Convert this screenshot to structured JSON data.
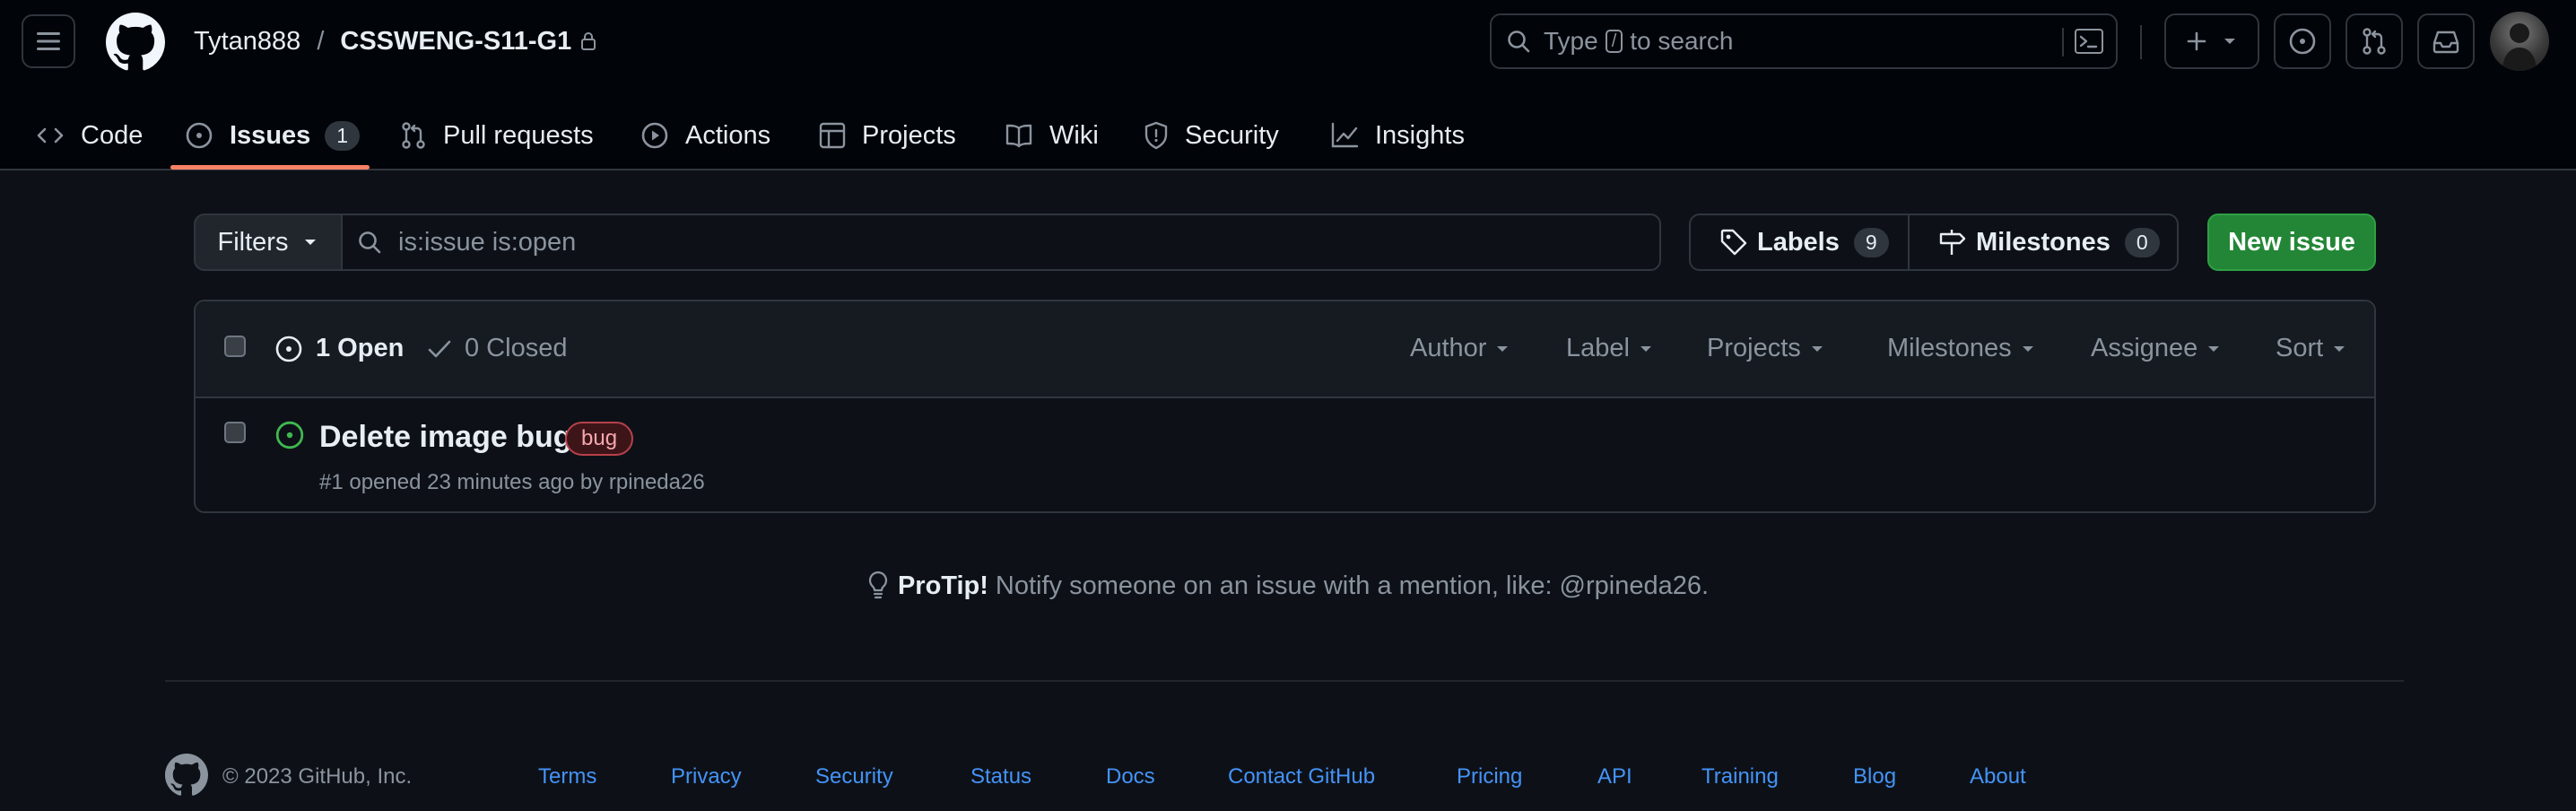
{
  "header": {
    "owner": "Tytan888",
    "separator": "/",
    "repo": "CSSWENG-S11-G1",
    "search_prefix": "Type",
    "search_key": "/",
    "search_suffix": "to search"
  },
  "nav": {
    "code": "Code",
    "issues": "Issues",
    "issues_count": "1",
    "pull_requests": "Pull requests",
    "actions": "Actions",
    "projects": "Projects",
    "wiki": "Wiki",
    "security": "Security",
    "insights": "Insights"
  },
  "toolbar": {
    "filters": "Filters",
    "query": "is:issue is:open",
    "labels": "Labels",
    "labels_count": "9",
    "milestones": "Milestones",
    "milestones_count": "0",
    "new_issue": "New issue"
  },
  "list": {
    "open": "1 Open",
    "closed": "0 Closed",
    "filters": {
      "author": "Author",
      "label": "Label",
      "projects": "Projects",
      "milestones": "Milestones",
      "assignee": "Assignee",
      "sort": "Sort"
    },
    "issues": [
      {
        "title": "Delete image bug",
        "label": "bug",
        "meta_prefix": "#1 opened 23 minutes ago by",
        "author": "rpineda26"
      }
    ]
  },
  "protip": {
    "strong": "ProTip!",
    "text": "Notify someone on an issue with a mention, like: @rpineda26."
  },
  "footer": {
    "copyright": "© 2023 GitHub, Inc.",
    "links": [
      "Terms",
      "Privacy",
      "Security",
      "Status",
      "Docs",
      "Contact GitHub",
      "Pricing",
      "API",
      "Training",
      "Blog",
      "About"
    ]
  },
  "colors": {
    "background": "#0d1117",
    "header_bg": "#010409",
    "accent_underline": "#f78166",
    "open_green": "#3fb950",
    "button_green": "#238636",
    "link_blue": "#4493f8",
    "bug_label": "#f85149"
  },
  "icons": [
    "hamburger-icon",
    "github-logo",
    "lock-icon",
    "search-icon",
    "command-palette-icon",
    "plus-icon",
    "issue-opened-icon",
    "git-pull-request-icon",
    "inbox-icon",
    "code-icon",
    "play-icon",
    "table-icon",
    "book-icon",
    "shield-icon",
    "graph-icon",
    "tag-icon",
    "milestone-icon",
    "check-icon",
    "light-bulb-icon"
  ]
}
